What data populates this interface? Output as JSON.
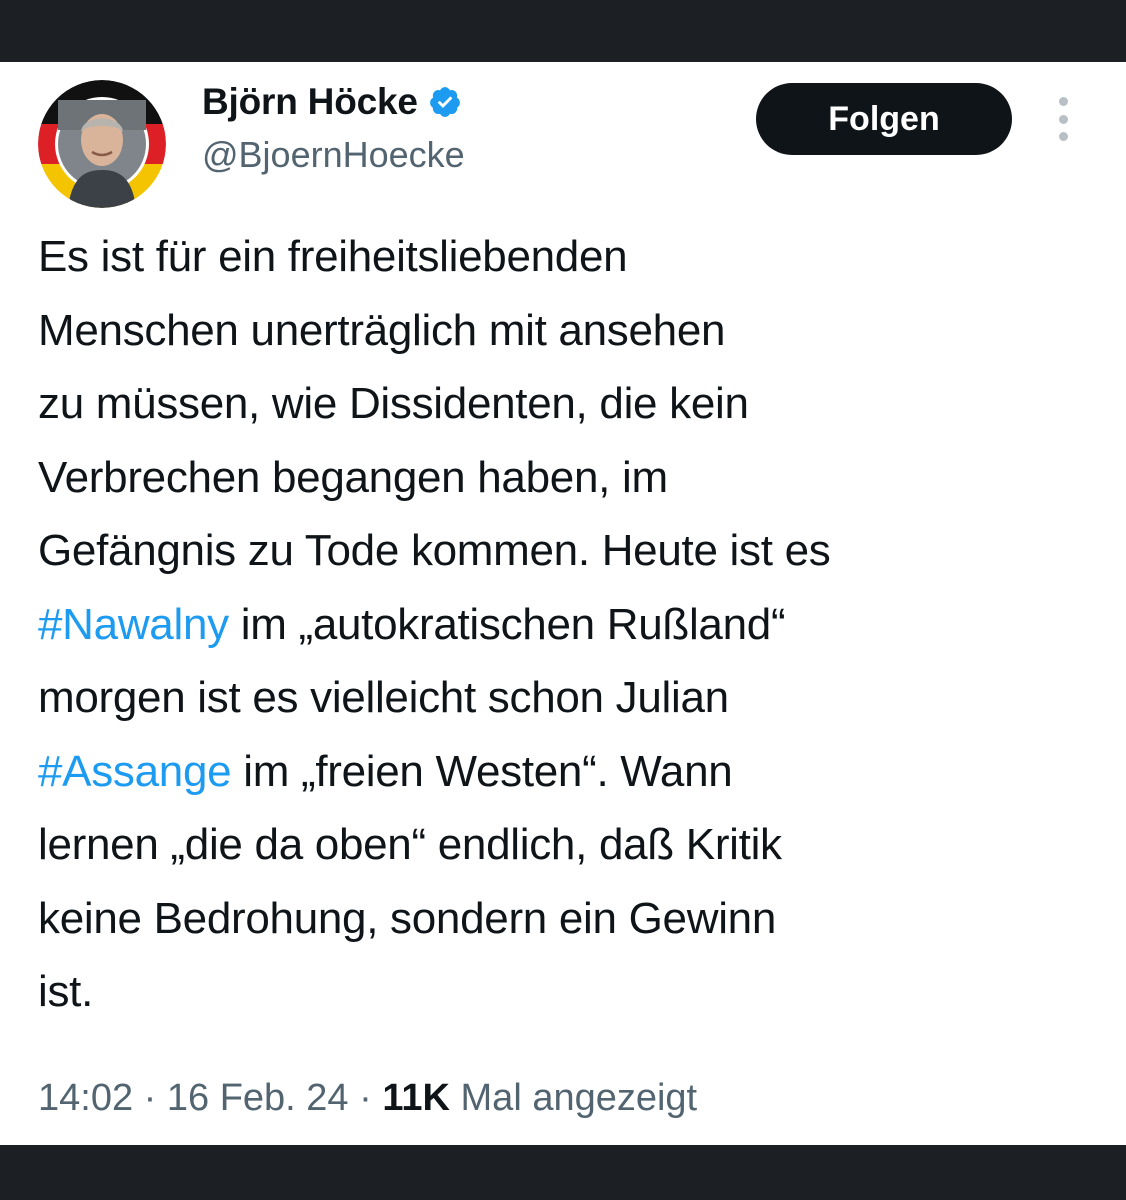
{
  "author": {
    "display_name": "Björn Höcke",
    "handle": "@BjoernHoecke",
    "verified": true,
    "avatar": "profile-photo-with-black-red-gold-ring"
  },
  "actions": {
    "follow_label": "Folgen",
    "more_icon": "more-vertical-icon"
  },
  "tweet": {
    "lines": {
      "l1": "Es ist für ein freiheitsliebenden",
      "l2": "Menschen unerträglich mit ansehen",
      "l3": "zu müssen, wie Dissidenten, die kein",
      "l4": "Verbrechen begangen haben, im",
      "l5": "Gefängnis zu Tode kommen. Heute ist es",
      "l6_hashtag": "#Nawalny",
      "l6_rest": " im „autokratischen Rußland“",
      "l7": "morgen ist es vielleicht schon Julian",
      "l8_hashtag": "#Assange",
      "l8_rest": " im „freien Westen“. Wann",
      "l9": "lernen „die da oben“ endlich, daß Kritik",
      "l10": "keine Bedrohung, sondern ein Gewinn",
      "l11": "ist."
    }
  },
  "meta": {
    "time": "14:02",
    "separator": " · ",
    "date": "16 Feb. 24",
    "views_count": "11K",
    "views_label": " Mal angezeigt"
  },
  "colors": {
    "link": "#1d9bf0",
    "text": "#0f1419",
    "muted": "#536471",
    "verified": "#1d9bf0",
    "frame": "#1c1f23"
  }
}
